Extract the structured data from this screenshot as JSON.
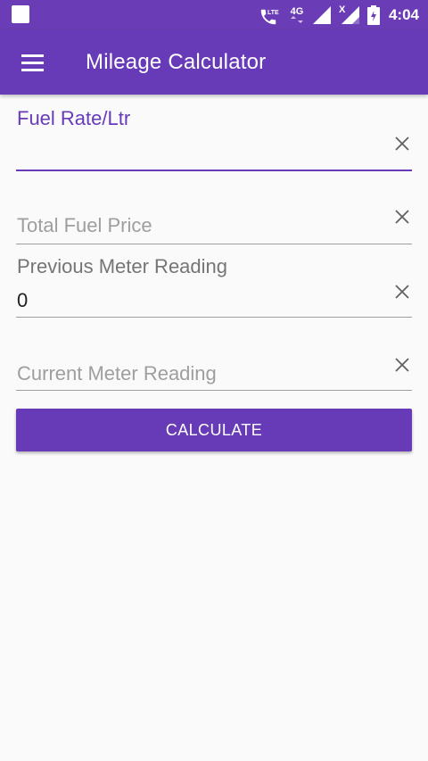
{
  "status_bar": {
    "lte_tag": "LTE",
    "network": "4G",
    "roaming_mark": "X",
    "time": "4:04",
    "icons": [
      "notification-square-icon",
      "volte-call-icon",
      "signal-icon",
      "signal-no-data-icon",
      "battery-icon"
    ]
  },
  "app_bar": {
    "title": "Mileage Calculator",
    "menu_icon": "hamburger-menu-icon"
  },
  "form": {
    "fuel_rate": {
      "label": "Fuel Rate/Ltr",
      "value": ""
    },
    "total_fuel_price": {
      "placeholder": "Total Fuel Price",
      "value": ""
    },
    "previous_meter": {
      "label": "Previous Meter Reading",
      "value": "0"
    },
    "current_meter": {
      "placeholder": "Current Meter Reading",
      "value": ""
    },
    "calculate_label": "CALCULATE"
  },
  "colors": {
    "primary": "#673AB7",
    "status_bar": "#6A3CB5",
    "background": "#FAFAFA",
    "hint": "#9E9E9E"
  }
}
